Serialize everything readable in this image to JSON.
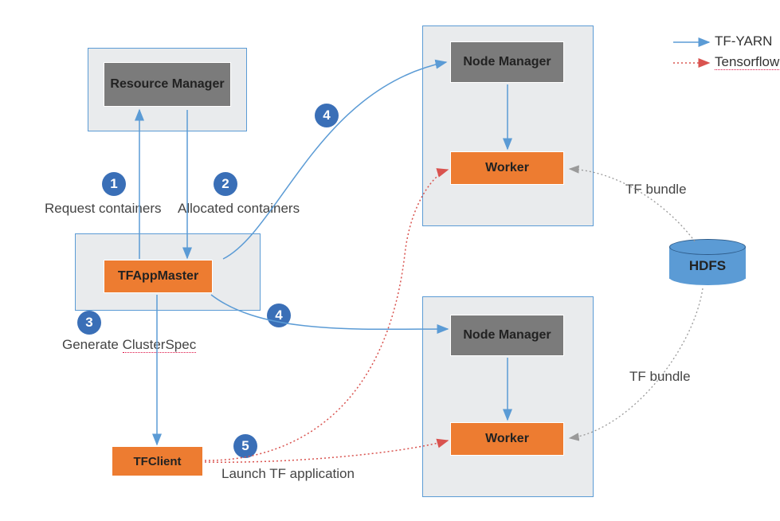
{
  "boxes": {
    "resourceManager": "Resource Manager",
    "nodeManager1": "Node Manager",
    "nodeManager2": "Node Manager",
    "worker1": "Worker",
    "worker2": "Worker",
    "tfAppMaster": "TFAppMaster",
    "tfClient": "TFClient"
  },
  "steps": {
    "s1": "1",
    "s2": "2",
    "s3": "3",
    "s4a": "4",
    "s4b": "4",
    "s5": "5"
  },
  "labels": {
    "requestContainers": "Request containers",
    "allocatedContainers": "Allocated containers",
    "generateClusterSpec_prefix": "Generate ",
    "generateClusterSpec_spell": "ClusterSpec",
    "launchTFApp": "Launch TF application",
    "tfBundle1": "TF bundle",
    "tfBundle2": "TF bundle"
  },
  "legend": {
    "tfyarn": "TF-YARN",
    "tensorflow": "Tensorflow"
  },
  "hdfs": "HDFS",
  "colors": {
    "blue": "#5b9bd5",
    "red": "#d9534f",
    "gray": "#888"
  }
}
